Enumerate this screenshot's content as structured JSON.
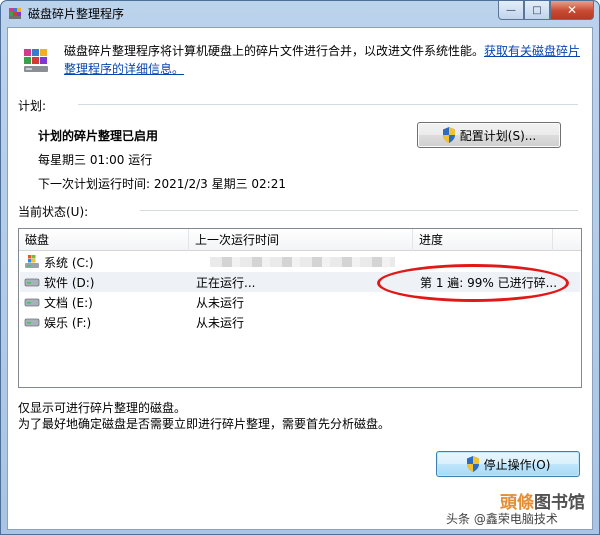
{
  "window": {
    "title": "磁盘碎片整理程序",
    "controls": {
      "minimize": "—",
      "maximize": "□",
      "close": "✕"
    }
  },
  "header": {
    "description": "磁盘碎片整理程序将计算机硬盘上的碎片文件进行合并，以改进文件系统性能。",
    "link": "获取有关磁盘碎片整理程序的详细信息。"
  },
  "schedule": {
    "section_label": "计划:",
    "status": "计划的碎片整理已启用",
    "frequency": "每星期三  01:00 运行",
    "next_run": "下一次计划运行时间: 2021/2/3 星期三 02:21",
    "configure_button": "配置计划(S)..."
  },
  "current_status": {
    "section_label": "当前状态(U):",
    "columns": [
      "磁盘",
      "上一次运行时间",
      "进度"
    ],
    "rows": [
      {
        "disk": "系统 (C:)",
        "last_run": "",
        "progress": "",
        "icon": "windows-drive-icon"
      },
      {
        "disk": "软件 (D:)",
        "last_run": "正在运行...",
        "progress": "第 1 遍: 99% 已进行碎...",
        "icon": "hard-drive-icon"
      },
      {
        "disk": "文档 (E:)",
        "last_run": "从未运行",
        "progress": "",
        "icon": "hard-drive-icon"
      },
      {
        "disk": "娱乐 (F:)",
        "last_run": "从未运行",
        "progress": "",
        "icon": "hard-drive-icon"
      }
    ]
  },
  "notes": {
    "line1": "仅显示可进行碎片整理的磁盘。",
    "line2": "为了最好地确定磁盘是否需要立即进行碎片整理，需要首先分析磁盘。"
  },
  "actions": {
    "stop_button": "停止操作(O)"
  },
  "watermark": {
    "site_accent": "頭條",
    "site_rest": "图书馆",
    "byline": "头条 @鑫荣电脑技术"
  },
  "colors": {
    "link": "#0645ad",
    "annotation": "#e01818",
    "title_bar": "#bcd3ec"
  }
}
